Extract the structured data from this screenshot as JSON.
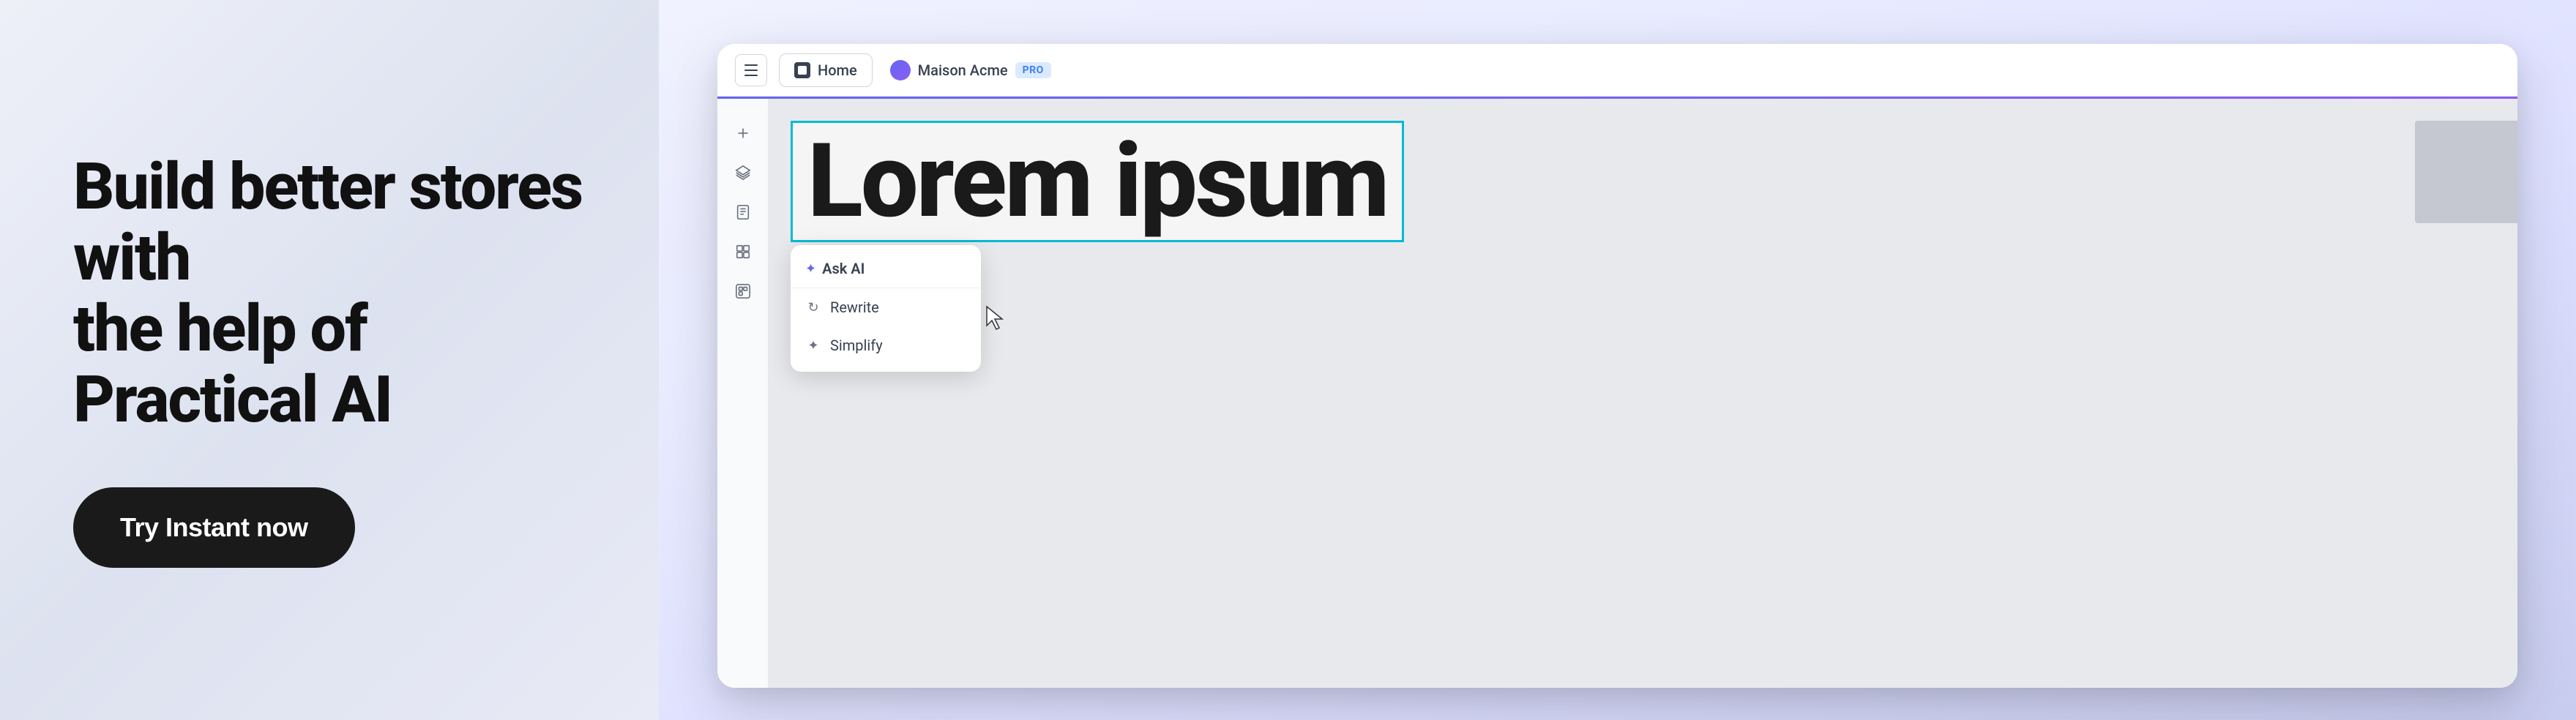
{
  "left": {
    "headline_line1": "Build better stores with",
    "headline_line2": "the help of Practical AI",
    "cta_label": "Try Instant now"
  },
  "right": {
    "topbar": {
      "hamburger_label": "menu",
      "home_tab_label": "Home",
      "workspace_name": "Maison Acme",
      "pro_badge": "PRO"
    },
    "sidebar": {
      "buttons": [
        {
          "name": "plus",
          "label": "Add"
        },
        {
          "name": "layers",
          "label": "Layers"
        },
        {
          "name": "document",
          "label": "Pages"
        },
        {
          "name": "components",
          "label": "Components"
        },
        {
          "name": "assets",
          "label": "Assets"
        }
      ]
    },
    "canvas": {
      "lorem_text": "Lorem ipsum"
    },
    "ai_popup": {
      "header": "Ask AI",
      "items": [
        {
          "icon": "rewrite",
          "label": "Rewrite"
        },
        {
          "icon": "simplify",
          "label": "Simplify"
        }
      ]
    }
  }
}
